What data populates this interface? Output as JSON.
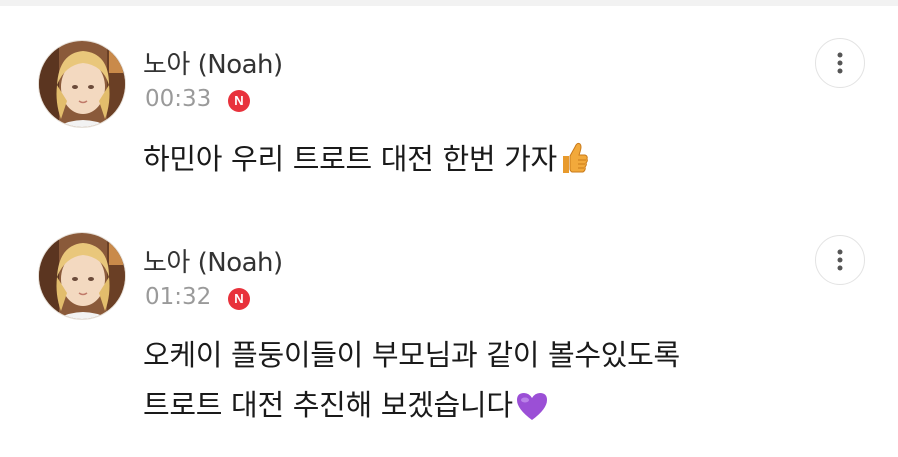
{
  "posts": [
    {
      "author": "노아 (Noah)",
      "time": "00:33",
      "badge": "N",
      "message_lines": [
        "하민아 우리 트로트 대전 한번 가자"
      ],
      "emoji": "thumbs-up-icon"
    },
    {
      "author": "노아 (Noah)",
      "time": "01:32",
      "badge": "N",
      "message_lines": [
        "오케이 플둥이들이 부모님과 같이 볼수있도록",
        "트로트 대전 추진해 보겠습니다"
      ],
      "emoji": "purple-heart-icon"
    }
  ],
  "colors": {
    "badge": "#e8323c",
    "time": "#9a9a9a",
    "author": "#333333",
    "message": "#1a1a1a",
    "heart": "#9b4fd6",
    "thumb": "#f2a93b"
  }
}
